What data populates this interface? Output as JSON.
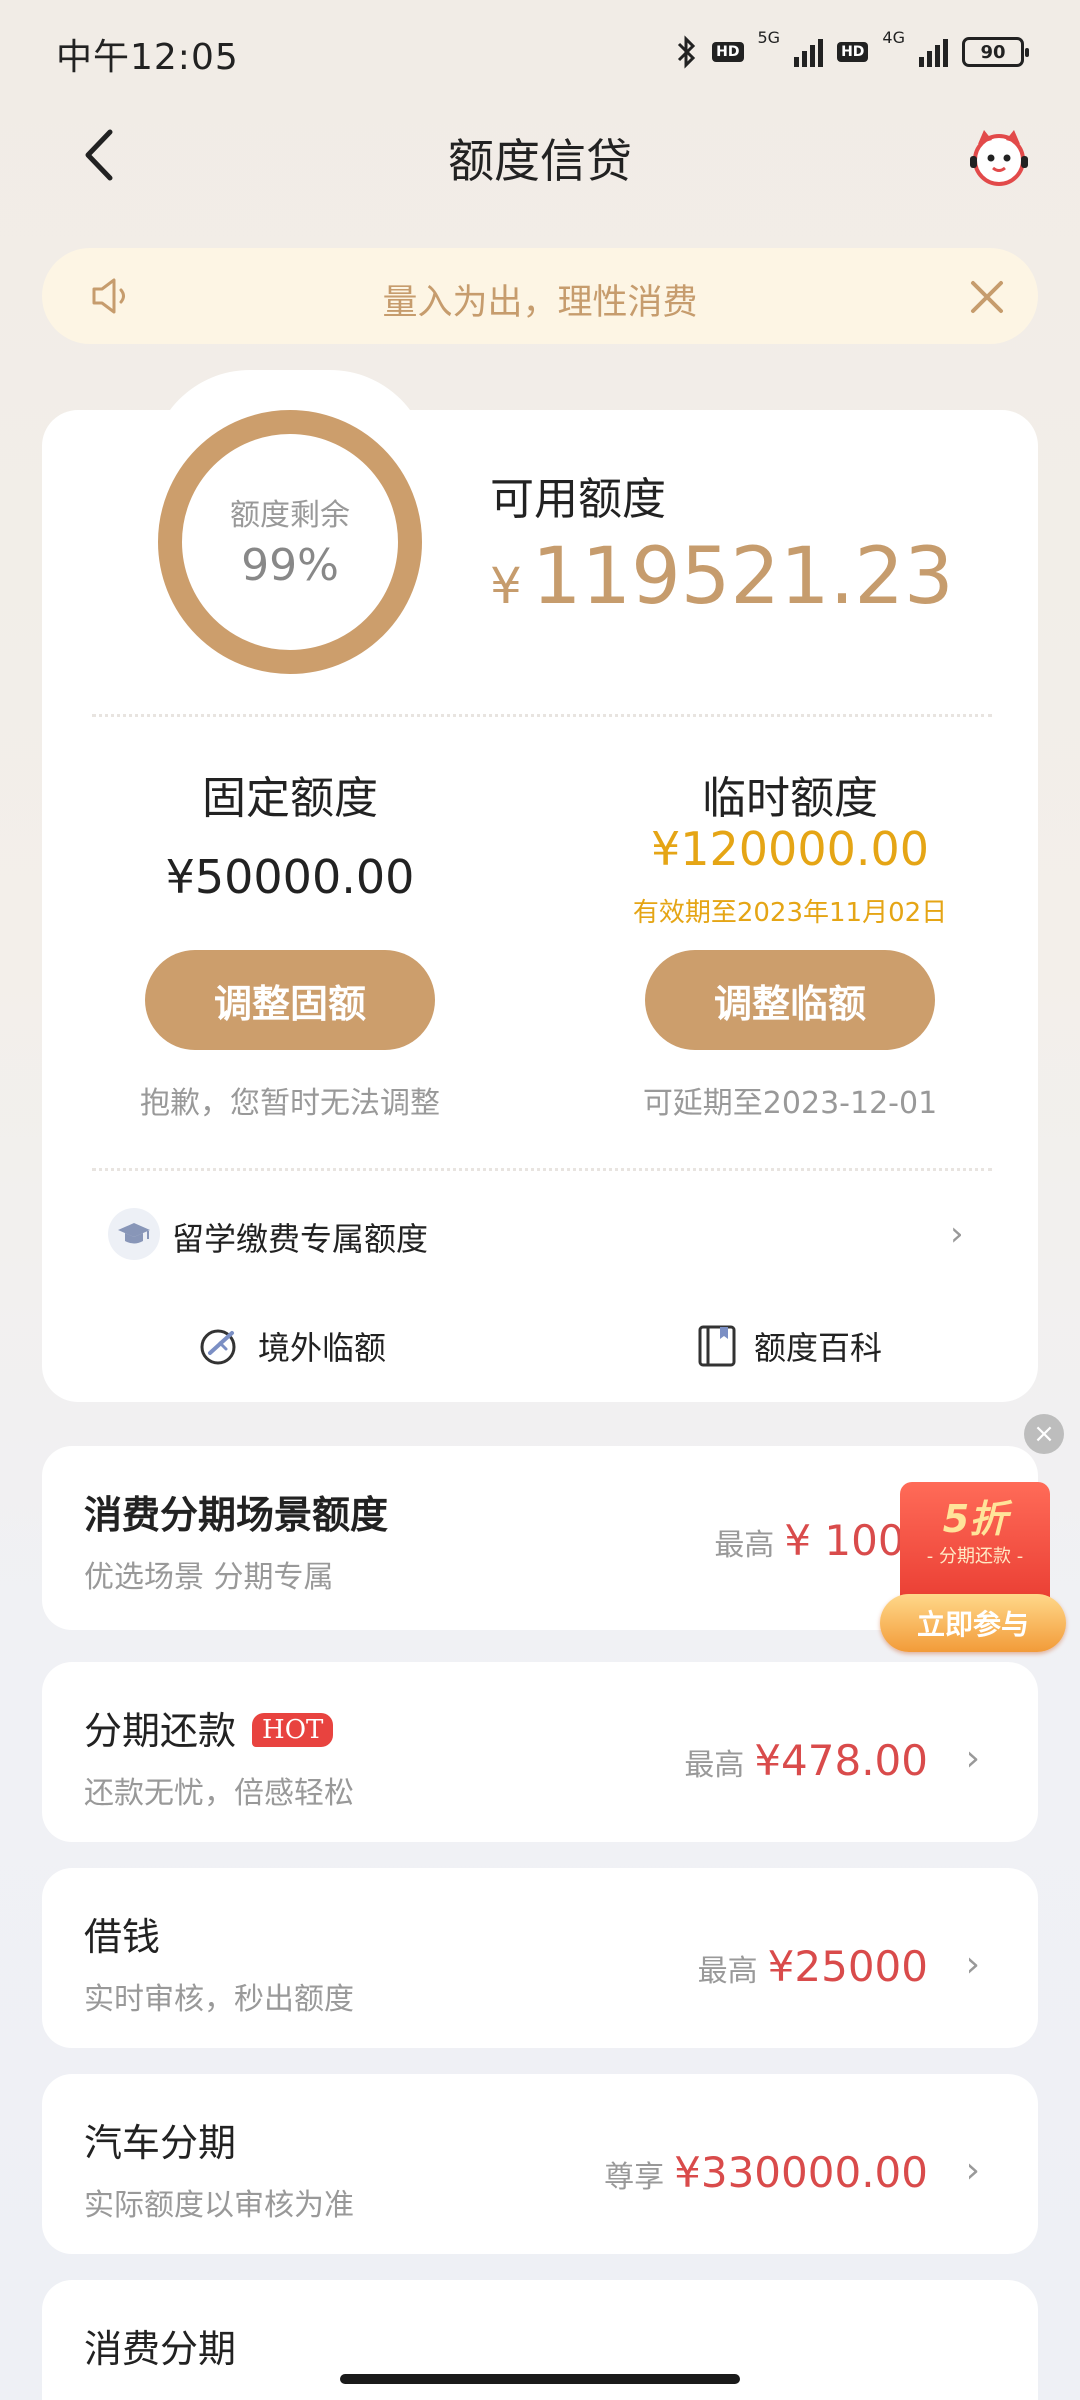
{
  "status_bar": {
    "time": "中午12:05",
    "hd1": "HD",
    "net1": "5G",
    "hd2": "HD",
    "net2": "4G",
    "battery": "90"
  },
  "nav": {
    "title": "额度信贷",
    "back_icon": "chevron-left-icon",
    "service_icon": "customer-service-mascot-icon"
  },
  "notice": {
    "text": "量入为出，理性消费",
    "icon": "speaker-icon"
  },
  "credit": {
    "ring_label": "额度剩余",
    "ring_value": "99%",
    "ring_fraction": 0.99,
    "available_label": "可用额度",
    "currency": "¥",
    "available_value": "119521.23"
  },
  "fixed": {
    "title": "固定额度",
    "value": "¥50000.00",
    "button": "调整固额",
    "note": "抱歉，您暂时无法调整"
  },
  "temporary": {
    "title": "临时额度",
    "value": "¥120000.00",
    "validity": "有效期至2023年11月02日",
    "button": "调整临额",
    "note": "可延期至2023-12-01"
  },
  "study_abroad": {
    "label": "留学缴费专属额度"
  },
  "links": {
    "overseas": "境外临额",
    "wiki": "额度百科"
  },
  "scene_card": {
    "title": "消费分期场景额度",
    "subtitle": "优选场景 分期专属",
    "prefix": "最高",
    "amount": "¥ 10000"
  },
  "promo": {
    "big": "5折",
    "small": "- 分期还款 -",
    "button": "立即参与"
  },
  "items": [
    {
      "title": "分期还款",
      "badge": "HOT",
      "subtitle": "还款无忧，倍感轻松",
      "prefix": "最高",
      "amount": "¥478.00"
    },
    {
      "title": "借钱",
      "subtitle": "实时审核，秒出额度",
      "prefix": "最高",
      "amount": "¥25000"
    },
    {
      "title": "汽车分期",
      "subtitle": "实际额度以审核为准",
      "prefix": "尊享",
      "amount": "¥330000.00"
    },
    {
      "title": "消费分期"
    }
  ],
  "colors": {
    "accent_gold": "#cc9e6c",
    "amount_red": "#d94b4b",
    "temp_yellow": "#e5a515",
    "hot_red": "#e8433f"
  }
}
